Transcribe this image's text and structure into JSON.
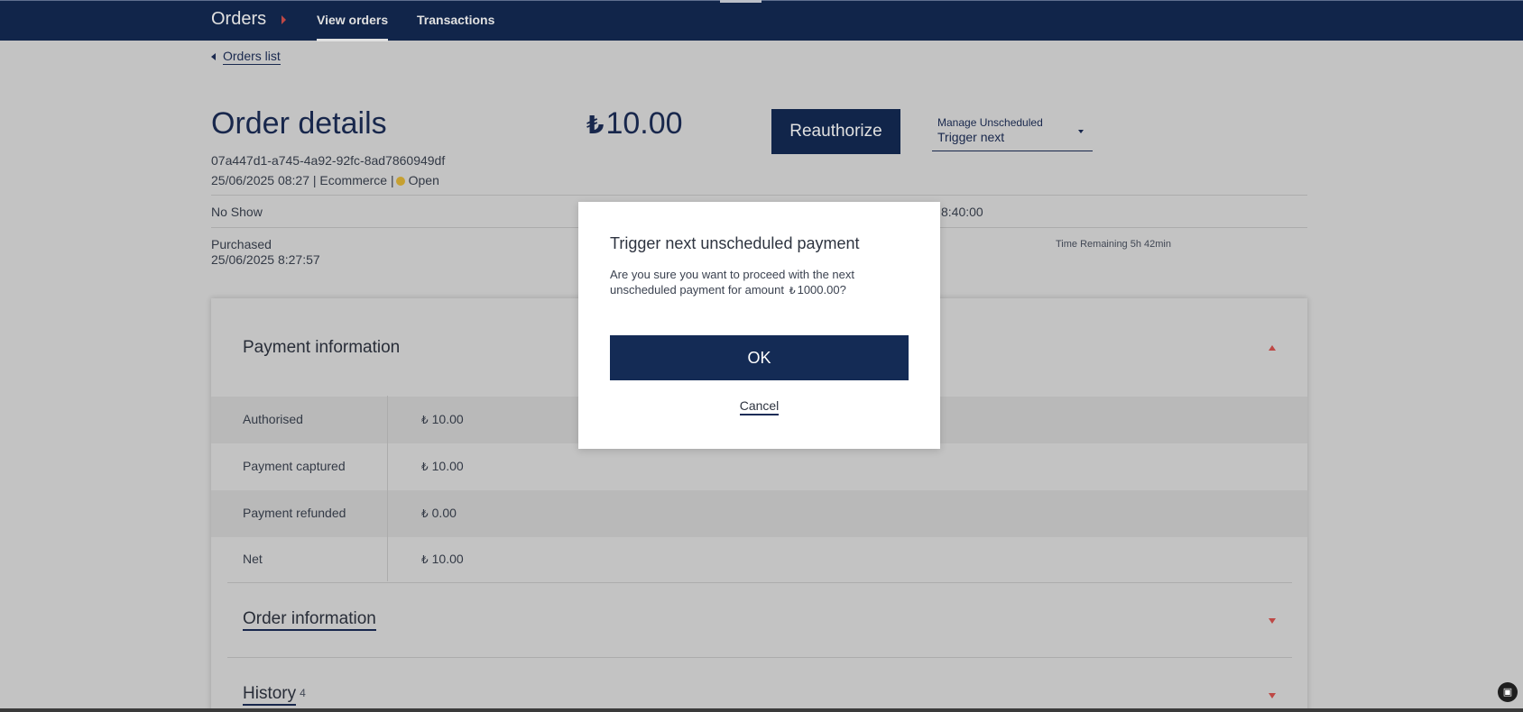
{
  "nav": {
    "brand": "Orders",
    "tabs": [
      {
        "label": "View orders",
        "active": true
      },
      {
        "label": "Transactions",
        "active": false
      }
    ]
  },
  "back_link": "Orders list",
  "header": {
    "title": "Order details",
    "currency_symbol": "₺",
    "amount": "10.00",
    "reauthorize_label": "Reauthorize",
    "manage_label": "Manage Unscheduled",
    "manage_value": "Trigger next",
    "order_id": "07a447d1-a745-4a92-92fc-8ad7860949df",
    "meta": "25/06/2025 08:27 | Ecommerce |",
    "status": "Open",
    "status_color": "#e2b738"
  },
  "info": {
    "no_show": "No Show",
    "time_value": "8:40:00",
    "purchased_label": "Purchased",
    "purchased_date": "25/06/2025 8:27:57",
    "time_remaining": "Time Remaining 5h 42min"
  },
  "payment": {
    "title": "Payment information",
    "rows": [
      {
        "label": "Authorised",
        "value": "10.00"
      },
      {
        "label": "Payment captured",
        "value": "10.00"
      },
      {
        "label": "Payment refunded",
        "value": "0.00"
      },
      {
        "label": "Net",
        "value": "10.00"
      }
    ]
  },
  "sections": {
    "order_information": "Order information",
    "history": "History",
    "history_count": "4"
  },
  "dialog": {
    "title": "Trigger next unscheduled payment",
    "text_before": "Are you sure you want to proceed with the next unscheduled payment for amount",
    "amount": "1000.00",
    "text_after": "?",
    "ok_label": "OK",
    "cancel_label": "Cancel"
  },
  "colors": {
    "navy": "#142b55",
    "accent_red": "#d9534f"
  }
}
